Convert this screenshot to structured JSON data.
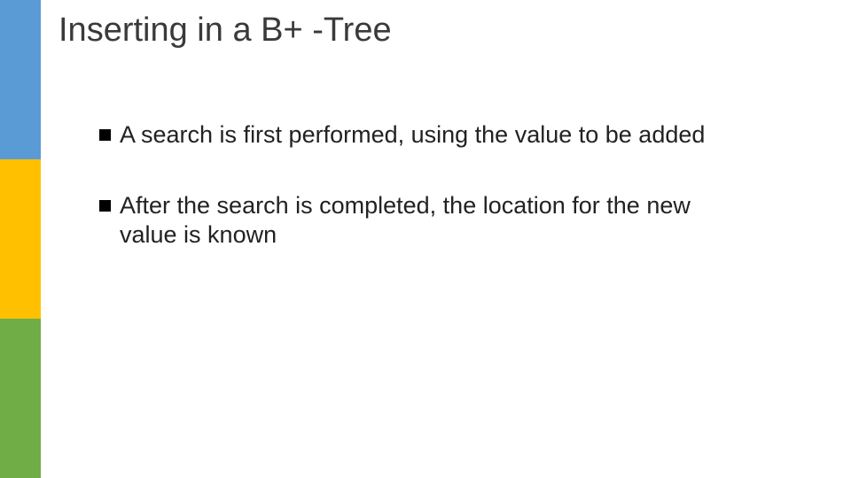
{
  "title": "Inserting in a B+ -Tree",
  "bullets": [
    "A search is first performed, using the value to be added",
    "After the search is completed, the location for the new value is known"
  ],
  "sidebar_colors": [
    "#5b9bd5",
    "#ffc000",
    "#70ad47"
  ]
}
